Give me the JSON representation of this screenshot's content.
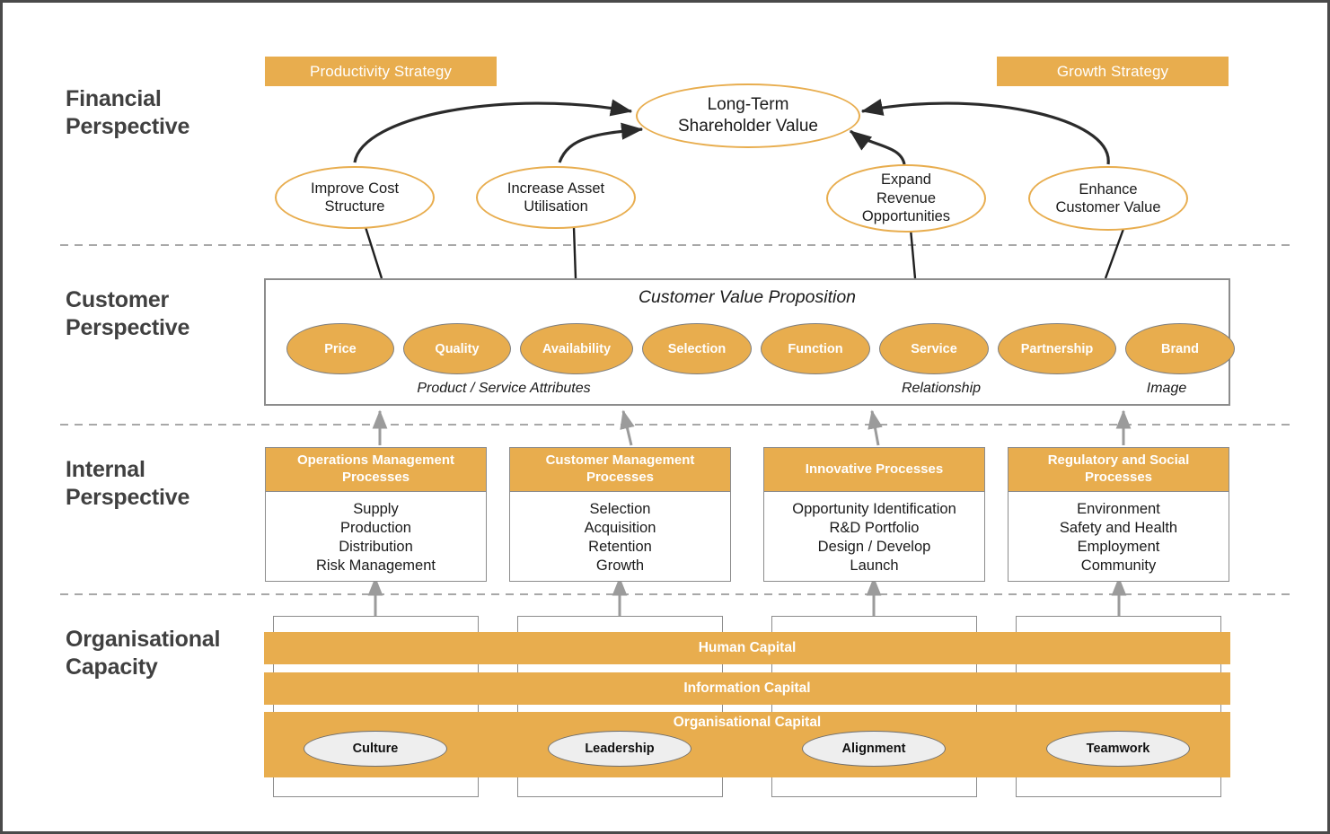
{
  "perspectives": [
    {
      "id": "financial",
      "label": "Financial\nPerspective"
    },
    {
      "id": "customer",
      "label": "Customer\nPerspective"
    },
    {
      "id": "internal",
      "label": "Internal\nPerspective"
    },
    {
      "id": "organisational",
      "label": "Organisational\nCapacity"
    }
  ],
  "strategies": [
    {
      "id": "productivity",
      "label": "Productivity Strategy"
    },
    {
      "id": "growth",
      "label": "Growth Strategy"
    }
  ],
  "financial": {
    "apex": "Long-Term\nShareholder Value",
    "objectives": [
      {
        "id": "improve-cost-structure",
        "label": "Improve Cost\nStructure"
      },
      {
        "id": "increase-asset-utilisation",
        "label": "Increase Asset\nUtilisation"
      },
      {
        "id": "expand-revenue-opportunities",
        "label": "Expand\nRevenue\nOpportunities"
      },
      {
        "id": "enhance-customer-value",
        "label": "Enhance\nCustomer Value"
      }
    ]
  },
  "customer": {
    "title": "Customer Value Proposition",
    "attributes": [
      {
        "id": "price",
        "label": "Price"
      },
      {
        "id": "quality",
        "label": "Quality"
      },
      {
        "id": "availability",
        "label": "Availability"
      },
      {
        "id": "selection",
        "label": "Selection"
      },
      {
        "id": "function",
        "label": "Function"
      },
      {
        "id": "service",
        "label": "Service"
      },
      {
        "id": "partnership",
        "label": "Partnership"
      },
      {
        "id": "brand",
        "label": "Brand"
      }
    ],
    "groups": [
      {
        "id": "product-service-attributes",
        "label": "Product / Service Attributes"
      },
      {
        "id": "relationship",
        "label": "Relationship"
      },
      {
        "id": "image",
        "label": "Image"
      }
    ]
  },
  "internal": {
    "processes": [
      {
        "id": "operations-management",
        "title": "Operations Management\nProcesses",
        "items": "Supply\nProduction\nDistribution\nRisk Management"
      },
      {
        "id": "customer-management",
        "title": "Customer Management\nProcesses",
        "items": "Selection\nAcquisition\nRetention\nGrowth"
      },
      {
        "id": "innovative",
        "title": "Innovative Processes",
        "items": "Opportunity Identification\nR&D Portfolio\nDesign / Develop\nLaunch"
      },
      {
        "id": "regulatory-social",
        "title": "Regulatory and Social\nProcesses",
        "items": "Environment\nSafety and Health\nEmployment\nCommunity"
      }
    ]
  },
  "organisational": {
    "bands": [
      {
        "id": "human-capital",
        "label": "Human Capital"
      },
      {
        "id": "information-capital",
        "label": "Information Capital"
      },
      {
        "id": "organisational-capital",
        "label": "Organisational Capital"
      }
    ],
    "enablers": [
      {
        "id": "culture",
        "label": "Culture"
      },
      {
        "id": "leadership",
        "label": "Leadership"
      },
      {
        "id": "alignment",
        "label": "Alignment"
      },
      {
        "id": "teamwork",
        "label": "Teamwork"
      }
    ]
  },
  "colors": {
    "accent_orange": "#e8ad4e",
    "border_gray": "#8c8c8c",
    "text_dark": "#1a1a1a",
    "arrow_dark": "#2b2b2b",
    "arrow_gray": "#9b9b9b"
  }
}
